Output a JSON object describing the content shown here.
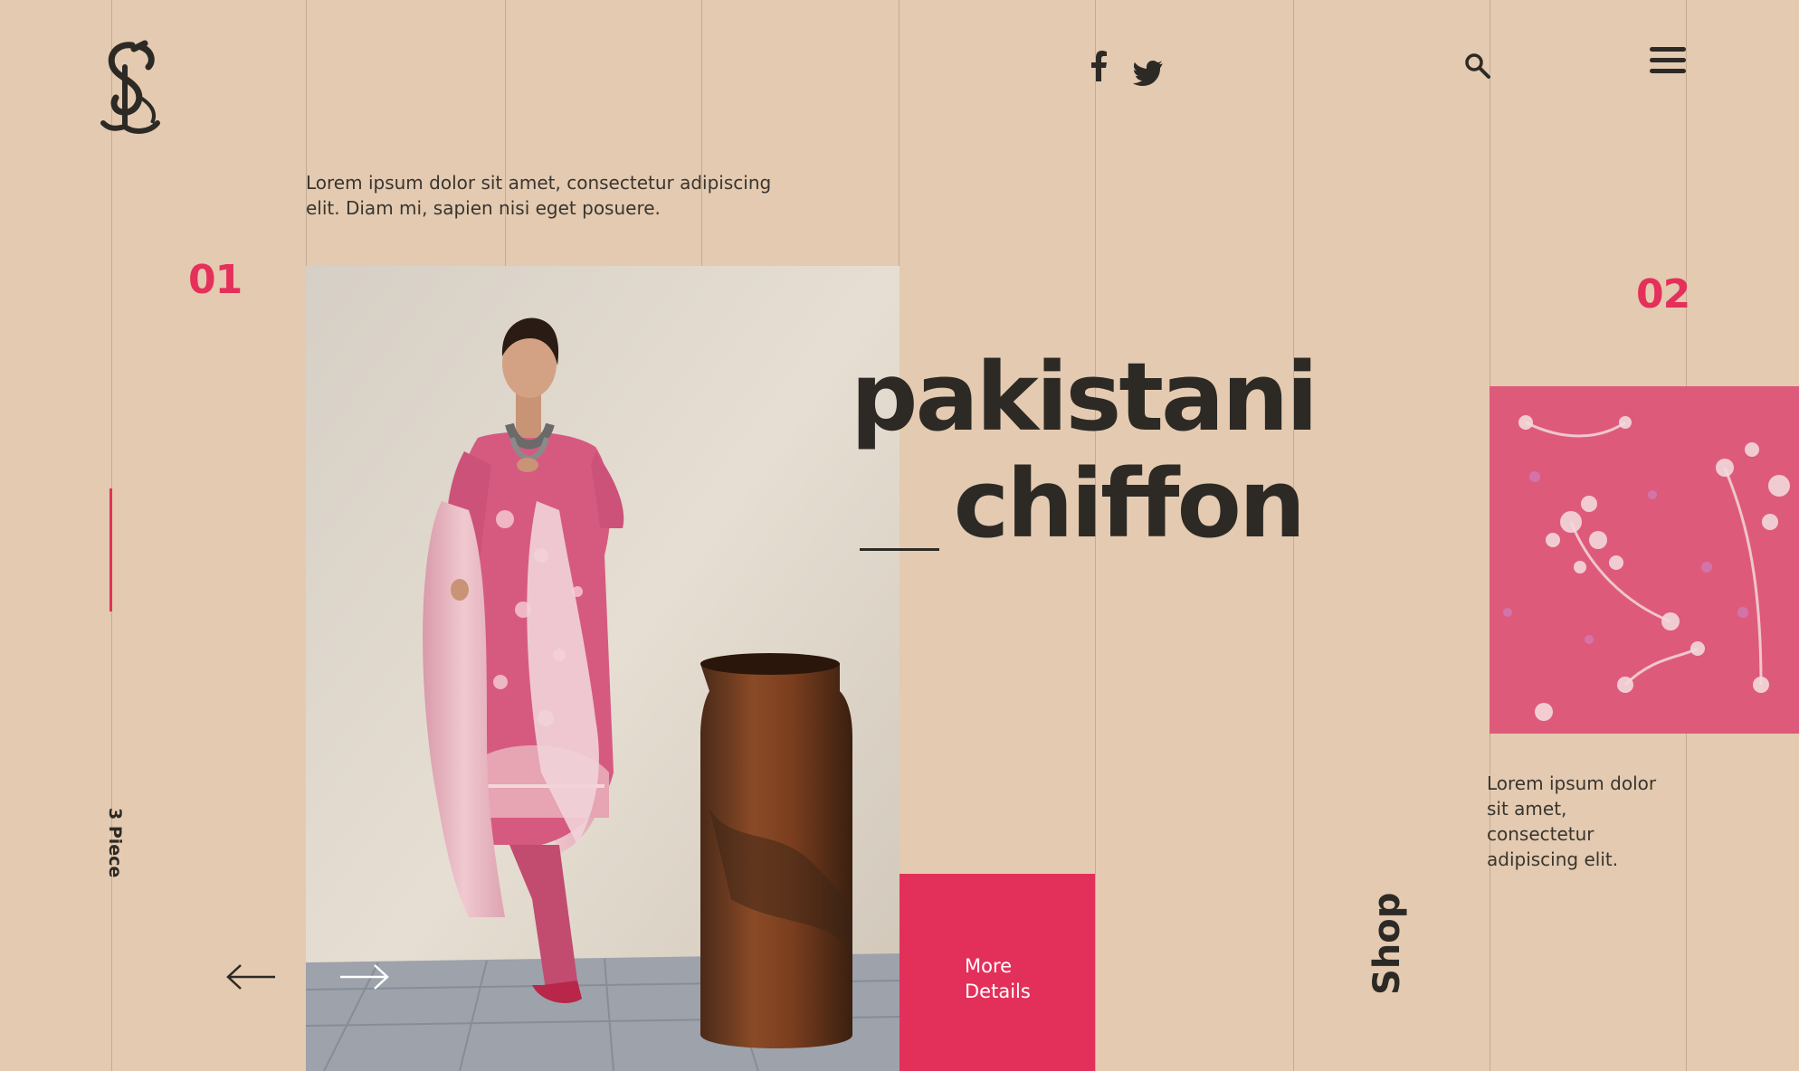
{
  "intro_text": "Lorem ipsum dolor sit amet, consectetur adipiscing elit. Diam mi, sapien nisi eget posuere.",
  "slide_number_1": "01",
  "slide_number_2": "02",
  "category_label": "3 Piece",
  "headline": {
    "line1": "pakistani",
    "line2": "chiffon"
  },
  "cta_label": "More Details",
  "shop_label": "Shop",
  "side_text": "Lorem ipsum dolor sit amet, consectetur adipiscing elit.",
  "icons": {
    "logo": "blackletter-s-logo",
    "facebook": "facebook-icon",
    "twitter": "twitter-icon",
    "search": "search-icon",
    "menu": "hamburger-menu-icon",
    "prev": "arrow-left-icon",
    "next": "arrow-right-icon"
  },
  "colors": {
    "background": "#e3cab1",
    "accent": "#e3305a",
    "text": "#2d2a25",
    "dress_pink": "#d65a80"
  }
}
